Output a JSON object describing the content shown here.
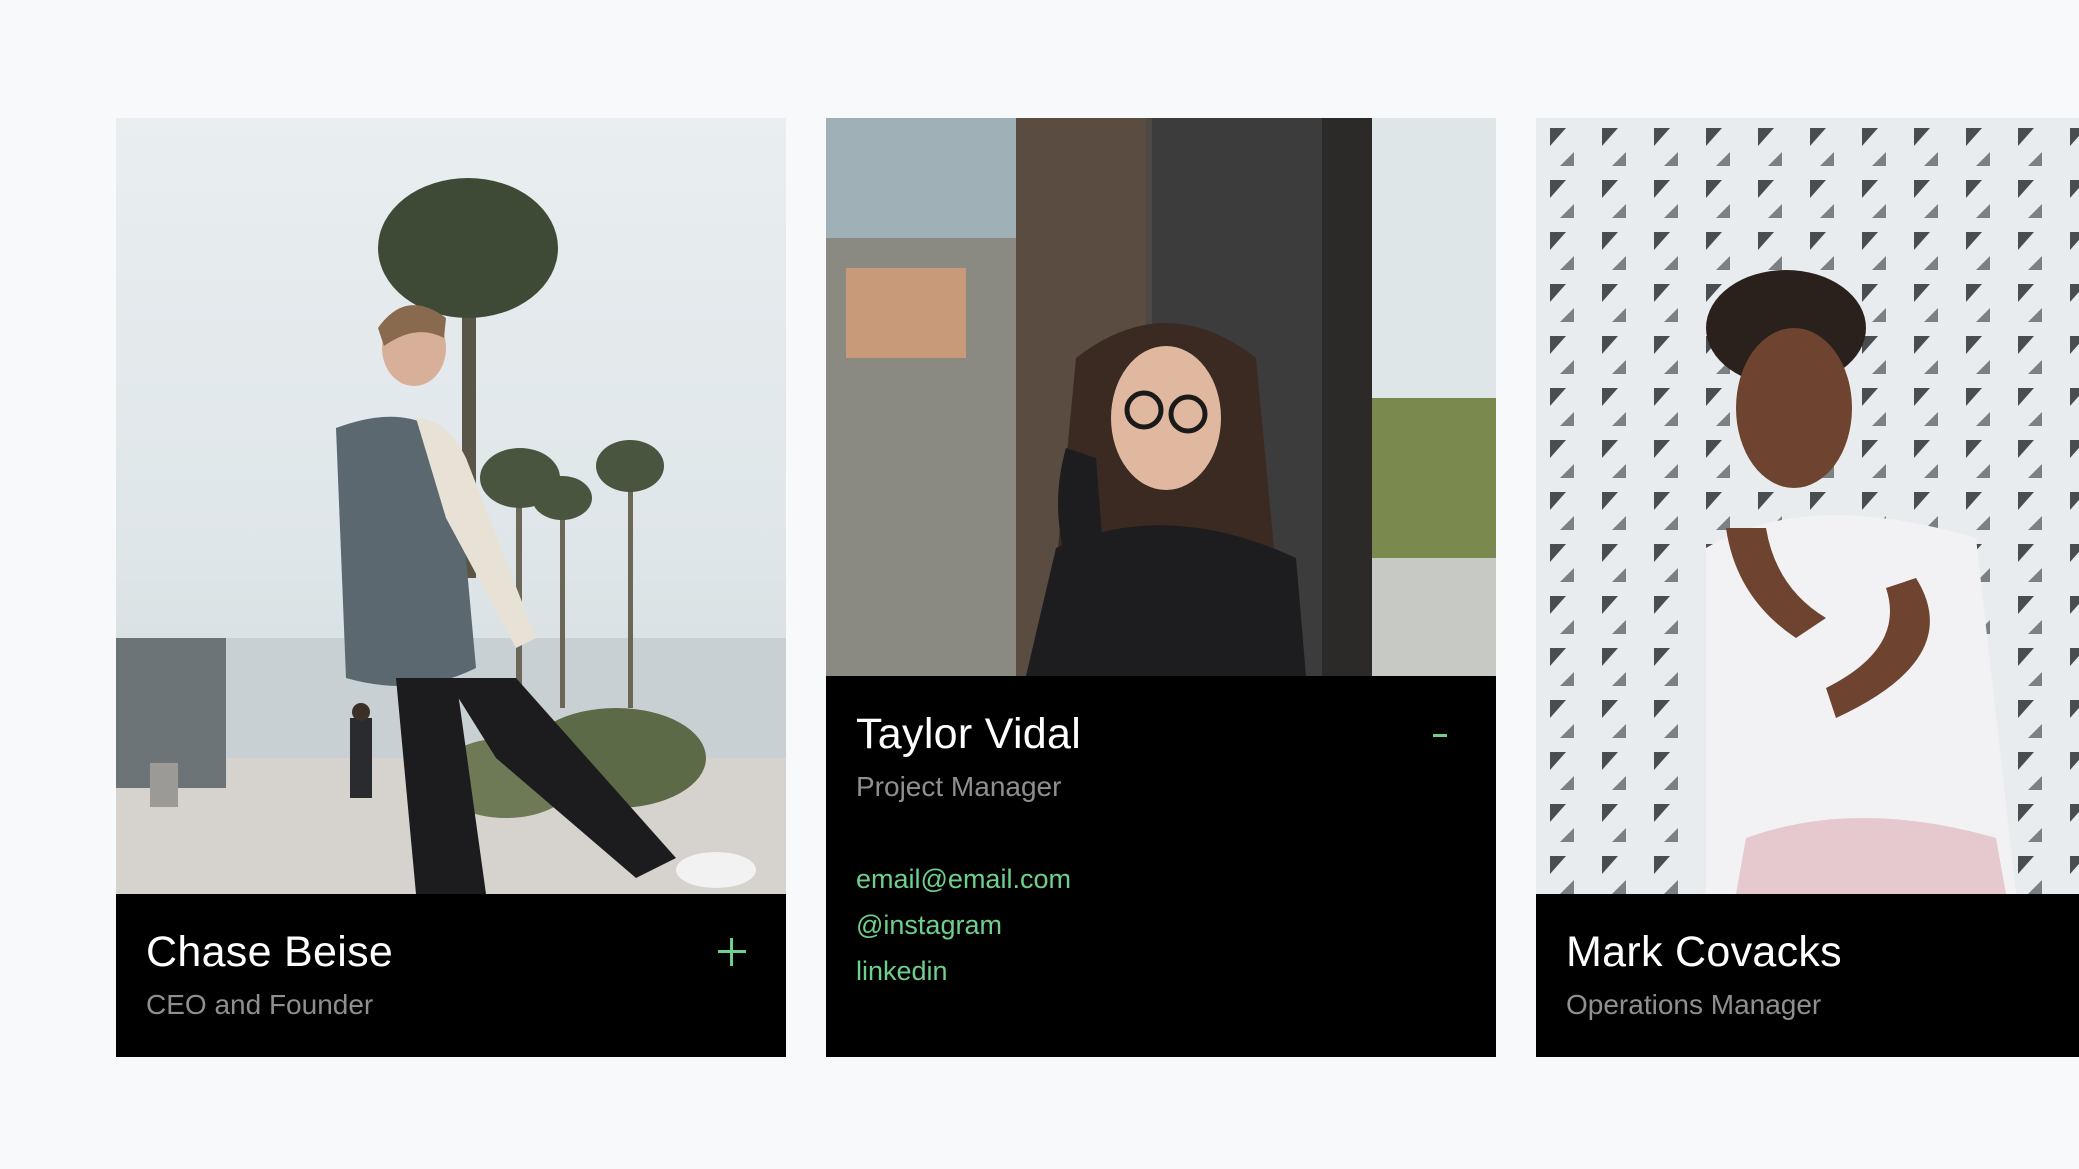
{
  "team": {
    "members": [
      {
        "name": "Chase Beise",
        "role": "CEO and Founder",
        "toggle_icon": "plus-icon",
        "expanded": false
      },
      {
        "name": "Taylor Vidal",
        "role": "Project Manager",
        "toggle_icon": "minus-icon",
        "expanded": true,
        "links": {
          "email": "email@email.com",
          "instagram": "@instagram",
          "linkedin": "linkedin"
        }
      },
      {
        "name": "Mark Covacks",
        "role": "Operations Manager",
        "toggle_icon": "plus-icon",
        "expanded": false
      }
    ]
  },
  "colors": {
    "page_background": "#f8f9fa",
    "card_background": "#000000",
    "accent": "#6fd08c",
    "name_text": "#ffffff",
    "role_text": "#8f8f8f"
  }
}
